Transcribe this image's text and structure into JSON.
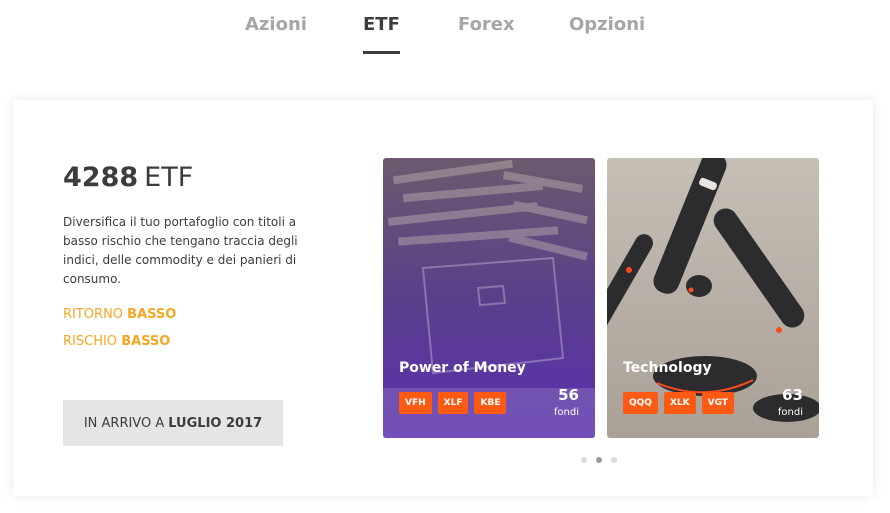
{
  "tabs": [
    {
      "label": "Azioni",
      "active": false
    },
    {
      "label": "ETF",
      "active": true
    },
    {
      "label": "Forex",
      "active": false
    },
    {
      "label": "Opzioni",
      "active": false
    }
  ],
  "summary": {
    "count": "4288",
    "unit": "ETF",
    "description": "Diversifica il tuo portafoglio con titoli a basso rischio che tengano traccia degli indici, delle commodity e dei panieri di consumo.",
    "metrics": [
      {
        "label": "RITORNO",
        "value": "BASSO"
      },
      {
        "label": "RISCHIO",
        "value": "BASSO"
      }
    ],
    "cta": {
      "prefix": "IN ARRIVO A",
      "date": "LUGLIO 2017"
    }
  },
  "funds": [
    {
      "name": "Power of Money",
      "tickers": [
        "VFH",
        "XLF",
        "KBE"
      ],
      "count": "56",
      "count_label": "fondi",
      "image": "money-briefcase-photo"
    },
    {
      "name": "Technology",
      "tickers": [
        "QQQ",
        "XLK",
        "VGT"
      ],
      "count": "63",
      "count_label": "fondi",
      "image": "tech-devices-photo"
    }
  ],
  "pagination": {
    "pages": 3,
    "active_index": 1
  },
  "colors": {
    "accent_orange": "#f5a623",
    "ticker_orange": "#ff5a14",
    "text_dark": "#3c3c3c",
    "tab_inactive": "#a6a6a6"
  }
}
